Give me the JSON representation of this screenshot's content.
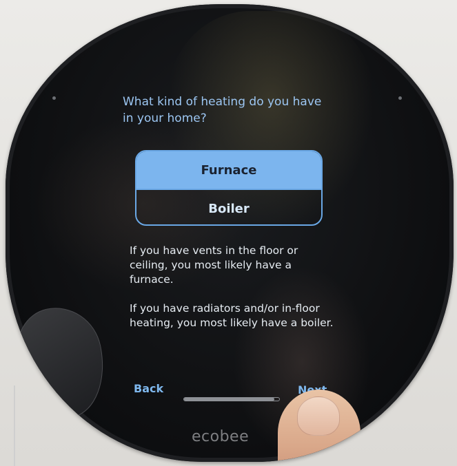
{
  "screen": {
    "question": "What kind of heating do you have in your home?",
    "options": [
      {
        "label": "Furnace",
        "selected": true
      },
      {
        "label": "Boiler",
        "selected": false
      }
    ],
    "help_paragraphs": [
      "If you have vents in the floor or ceiling, you most likely have a furnace.",
      "If you have radiators and/or in-floor heating, you most likely have a boiler."
    ],
    "nav": {
      "back_label": "Back",
      "next_label": "Next"
    },
    "progress": 0.95
  },
  "device": {
    "brand": "ecobee"
  },
  "colors": {
    "accent": "#7cb5ee",
    "text_light": "#e6ecf2",
    "screen_bg": "#101113"
  }
}
